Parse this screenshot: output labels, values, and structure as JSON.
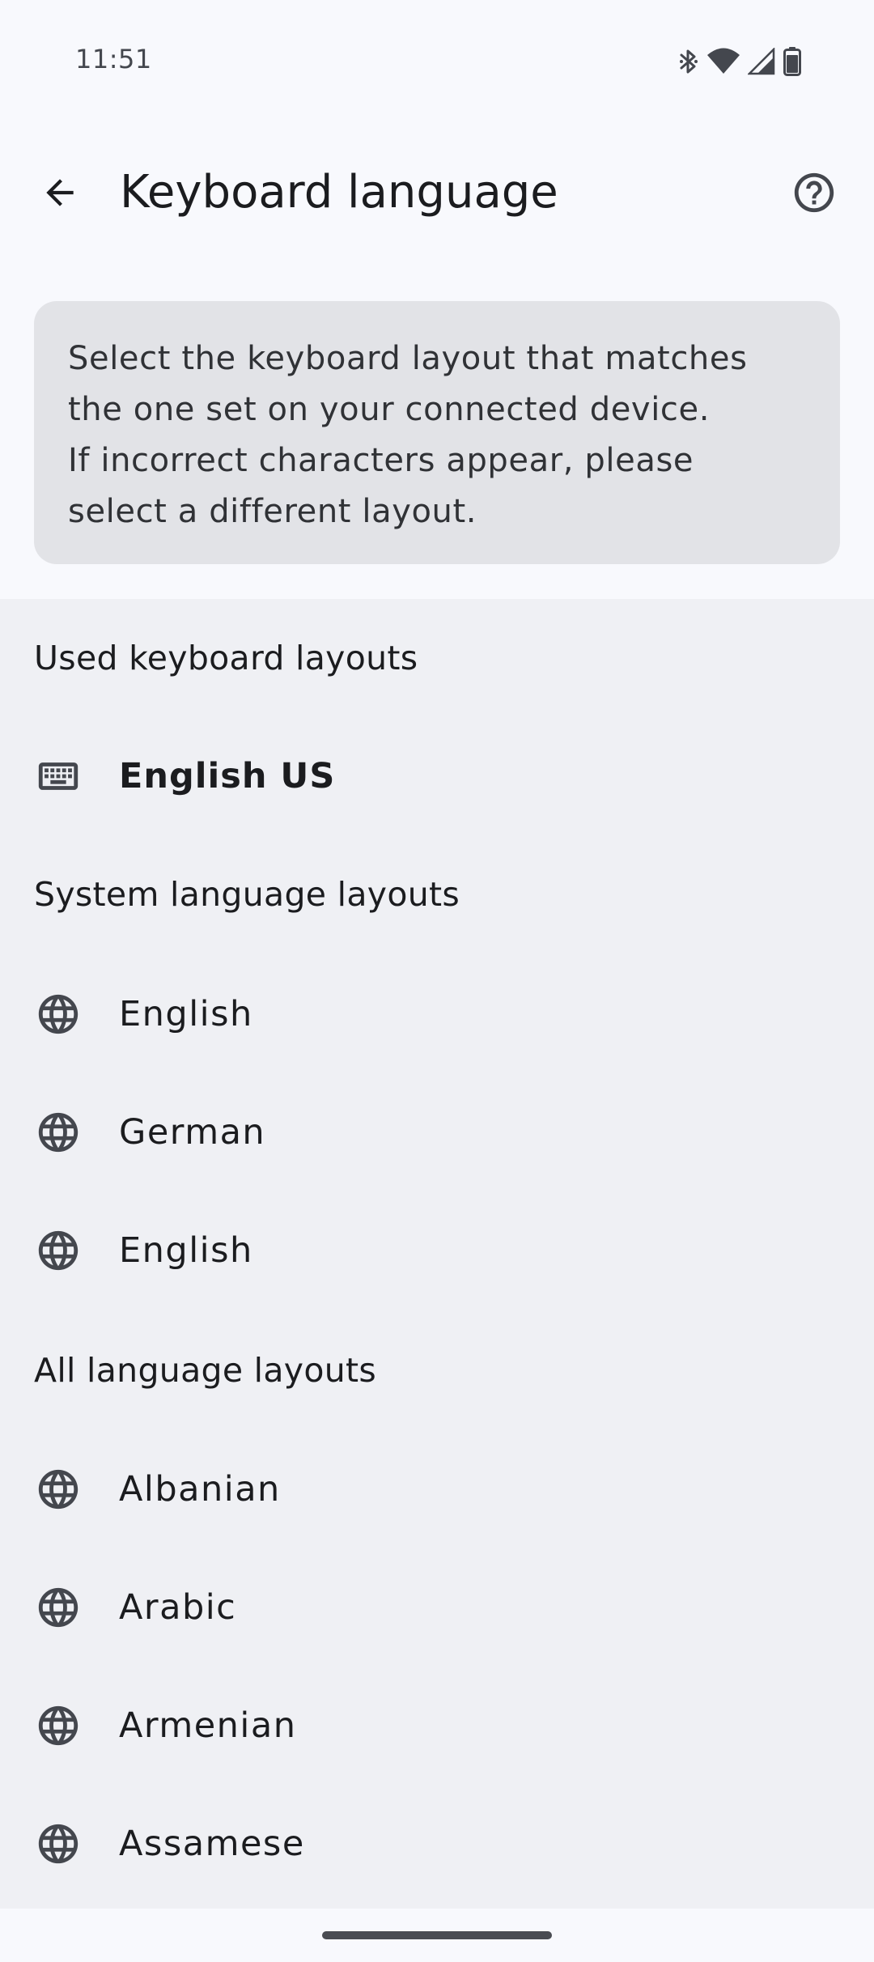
{
  "status_bar": {
    "time": "11:51",
    "icons": [
      "bluetooth-icon",
      "wifi-icon",
      "cellular-signal-icon",
      "battery-icon"
    ]
  },
  "app_bar": {
    "title": "Keyboard language",
    "back_icon": "arrow-back-icon",
    "help_icon": "help-circle-icon"
  },
  "info_card": {
    "lines": [
      "Select the keyboard layout that matches",
      "the one set on your connected device.",
      "If incorrect characters appear, please",
      "select a different layout."
    ]
  },
  "sections": {
    "used": {
      "header": "Used keyboard layouts",
      "items": [
        {
          "label": "English US",
          "icon": "keyboard-icon"
        }
      ]
    },
    "system": {
      "header": "System language layouts",
      "items": [
        {
          "label": "English",
          "icon": "globe-icon"
        },
        {
          "label": "German",
          "icon": "globe-icon"
        },
        {
          "label": "English",
          "icon": "globe-icon"
        }
      ]
    },
    "all": {
      "header": "All language layouts",
      "items": [
        {
          "label": "Albanian",
          "icon": "globe-icon"
        },
        {
          "label": "Arabic",
          "icon": "globe-icon"
        },
        {
          "label": "Armenian",
          "icon": "globe-icon"
        },
        {
          "label": "Assamese",
          "icon": "globe-icon"
        }
      ]
    }
  },
  "colors": {
    "page_background": "#f8f9fd",
    "list_background": "#eff0f4",
    "card_background": "#e2e3e7",
    "icon_color": "#44474e",
    "text_primary": "#1b1c1f"
  }
}
